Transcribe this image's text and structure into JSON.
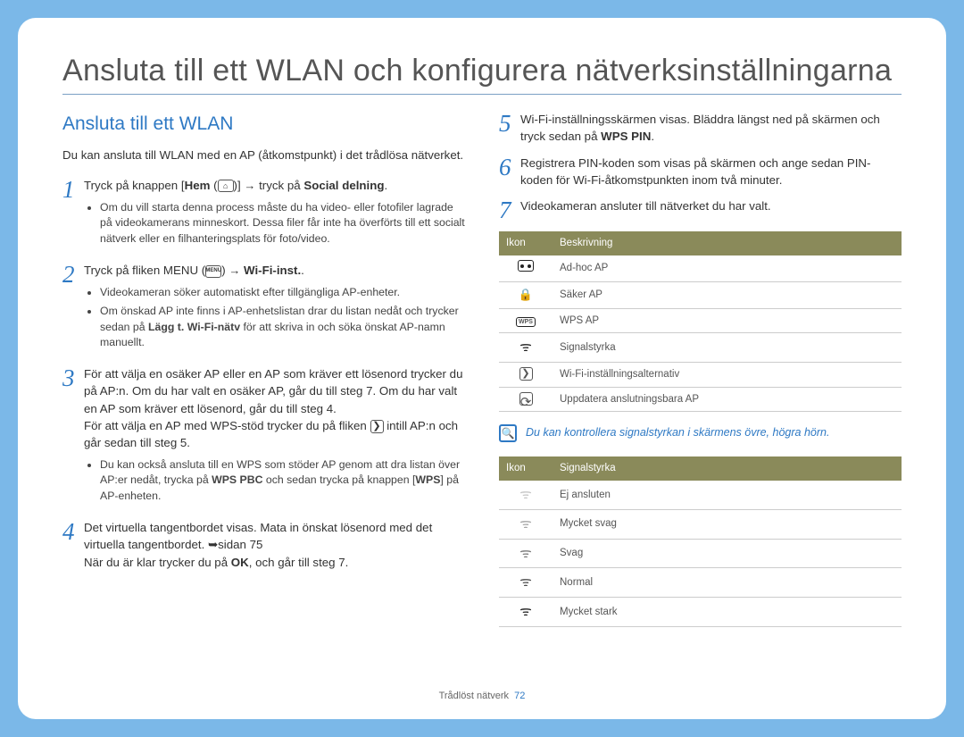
{
  "title": "Ansluta till ett WLAN och konfigurera nätverksinställningarna",
  "sub_heading": "Ansluta till ett WLAN",
  "intro": "Du kan ansluta till WLAN med en AP (åtkomstpunkt) i det trådlösa nätverket.",
  "steps": {
    "s1": {
      "num": "1",
      "pre": "Tryck på knappen [",
      "hem": "Hem",
      "post": " tryck på ",
      "bold": "Social delning",
      "end": "."
    },
    "s1_note": "Om du vill starta denna process måste du ha video- eller fotofiler lagrade på videokamerans minneskort. Dessa filer får inte ha överförts till ett socialt nätverk eller en filhanteringsplats för foto/video.",
    "s2": {
      "num": "2",
      "pre": "Tryck på fliken MENU (",
      "post": ") ",
      "bold": "Wi-Fi-inst.",
      "end": "."
    },
    "s2_b1": "Videokameran söker automatiskt efter tillgängliga AP-enheter.",
    "s2_b2_pre": "Om önskad AP inte finns i AP-enhetslistan drar du listan nedåt och trycker sedan på ",
    "s2_b2_bold": "Lägg t. Wi-Fi-nätv",
    "s2_b2_post": " för att skriva in och söka önskat AP-namn manuellt.",
    "s3": {
      "num": "3",
      "text": "För att välja en osäker AP eller en AP som kräver ett lösenord trycker du på AP:n. Om du har valt en osäker AP, går du till steg 7. Om du har valt en AP som kräver ett lösenord, går du till steg 4."
    },
    "s3_extra_pre": "För att välja en AP med WPS-stöd trycker du på fliken ",
    "s3_extra_post": " intill AP:n och går sedan till steg 5.",
    "s3_b_pre": "Du kan också ansluta till en WPS som stöder AP genom att dra listan över AP:er nedåt, trycka på ",
    "s3_b_bold1": "WPS PBC",
    "s3_b_mid": " och sedan trycka på knappen [",
    "s3_b_bold2": "WPS",
    "s3_b_post": "] på AP-enheten.",
    "s4": {
      "num": "4",
      "text_pre": "Det virtuella tangentbordet visas. Mata in önskat lösenord med det virtuella tangentbordet. ",
      "arrow_text": "sidan 75"
    },
    "s4_line2_pre": "När du är klar trycker du på ",
    "s4_line2_bold": "OK",
    "s4_line2_post": ", och går till steg 7.",
    "s5": {
      "num": "5",
      "text_pre": "Wi-Fi-inställningsskärmen visas. Bläddra längst ned på skärmen och tryck sedan på ",
      "bold": "WPS PIN",
      "end": "."
    },
    "s6": {
      "num": "6",
      "text": "Registrera PIN-koden som visas på skärmen och ange sedan PIN-koden för Wi-Fi-åtkomstpunkten inom två minuter."
    },
    "s7": {
      "num": "7",
      "text": "Videokameran ansluter till nätverket du har valt."
    }
  },
  "table1": {
    "h1": "Ikon",
    "h2": "Beskrivning",
    "rows": [
      {
        "desc": "Ad-hoc AP"
      },
      {
        "desc": "Säker AP"
      },
      {
        "desc": "WPS AP"
      },
      {
        "desc": "Signalstyrka"
      },
      {
        "desc": "Wi-Fi-inställningsalternativ"
      },
      {
        "desc": "Uppdatera anslutningsbara AP"
      }
    ]
  },
  "note": "Du kan kontrollera signalstyrkan i skärmens övre, högra hörn.",
  "table2": {
    "h1": "Ikon",
    "h2": "Signalstyrka",
    "rows": [
      {
        "desc": "Ej ansluten"
      },
      {
        "desc": "Mycket svag"
      },
      {
        "desc": "Svag"
      },
      {
        "desc": "Normal"
      },
      {
        "desc": "Mycket stark"
      }
    ]
  },
  "footer": {
    "section": "Trådlöst nätverk",
    "page": "72"
  },
  "icons": {
    "home": "⌂",
    "menu": "MENU",
    "chevron": "❯",
    "refresh": "⟳",
    "mag": "🔍",
    "wps": "WPS"
  }
}
